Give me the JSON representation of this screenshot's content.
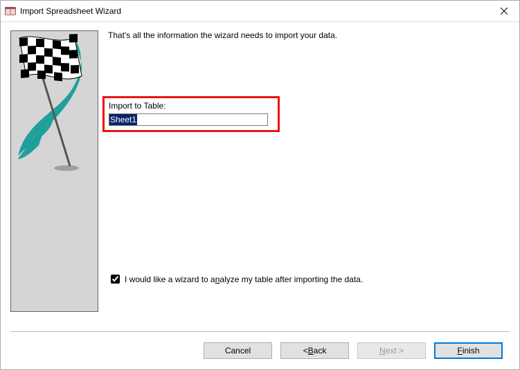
{
  "window": {
    "title": "Import Spreadsheet Wizard"
  },
  "intro": "That's all the information the wizard needs to import your data.",
  "import_table": {
    "label": "Import to Table:",
    "value": "Sheet1"
  },
  "analyze_checkbox": {
    "checked": true,
    "prefix": "I would like a wizard to a",
    "hotkey": "n",
    "suffix": "alyze my table after importing the data."
  },
  "buttons": {
    "cancel": "Cancel",
    "back_prefix": "< ",
    "back_hotkey": "B",
    "back_suffix": "ack",
    "next_hotkey": "N",
    "next_suffix": "ext >",
    "finish_hotkey": "F",
    "finish_suffix": "inish"
  }
}
